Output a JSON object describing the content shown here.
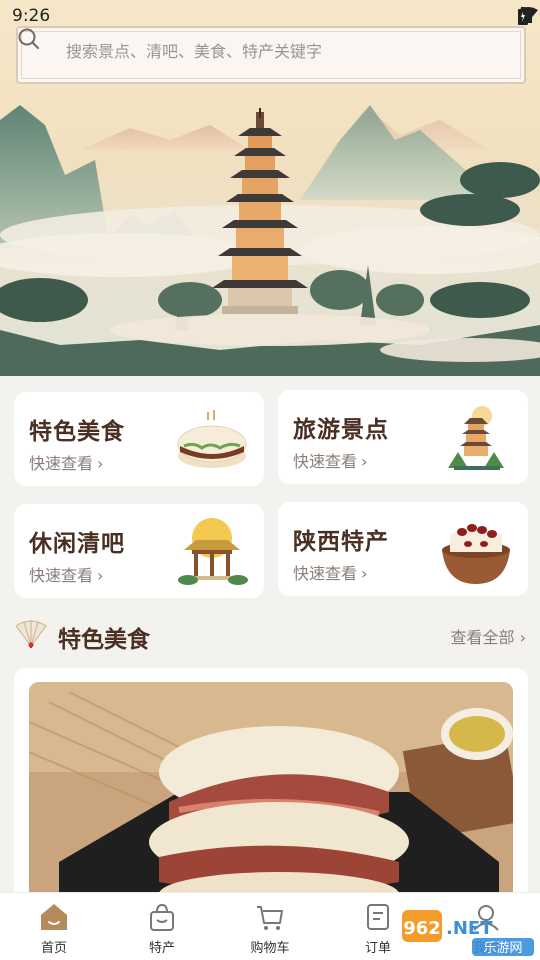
{
  "status_bar": {
    "time": "9:26"
  },
  "search": {
    "placeholder": "搜索景点、清吧、美食、特产关键字"
  },
  "categories": [
    {
      "title": "特色美食",
      "subtitle": "快速查看",
      "icon": "roujiamo-icon"
    },
    {
      "title": "旅游景点",
      "subtitle": "快速查看",
      "icon": "pagoda-icon"
    },
    {
      "title": "休闲清吧",
      "subtitle": "快速查看",
      "icon": "pavilion-icon"
    },
    {
      "title": "陕西特产",
      "subtitle": "快速查看",
      "icon": "date-cake-icon"
    }
  ],
  "section": {
    "title": "特色美食",
    "see_all": "查看全部",
    "icon": "folding-fan-icon"
  },
  "bottom_nav": [
    {
      "label": "首页",
      "icon": "home-icon",
      "active": true
    },
    {
      "label": "特产",
      "icon": "shopping-bag-icon"
    },
    {
      "label": "购物车",
      "icon": "cart-icon"
    },
    {
      "label": "订单",
      "icon": "order-icon"
    },
    {
      "label": "我的",
      "icon": "profile-icon"
    }
  ],
  "watermark": {
    "brand": "962.NET",
    "sub": "乐游网"
  },
  "colors": {
    "title_brown": "#4a2f22",
    "accent": "#b58a5c",
    "bg": "#f4f2ee"
  }
}
